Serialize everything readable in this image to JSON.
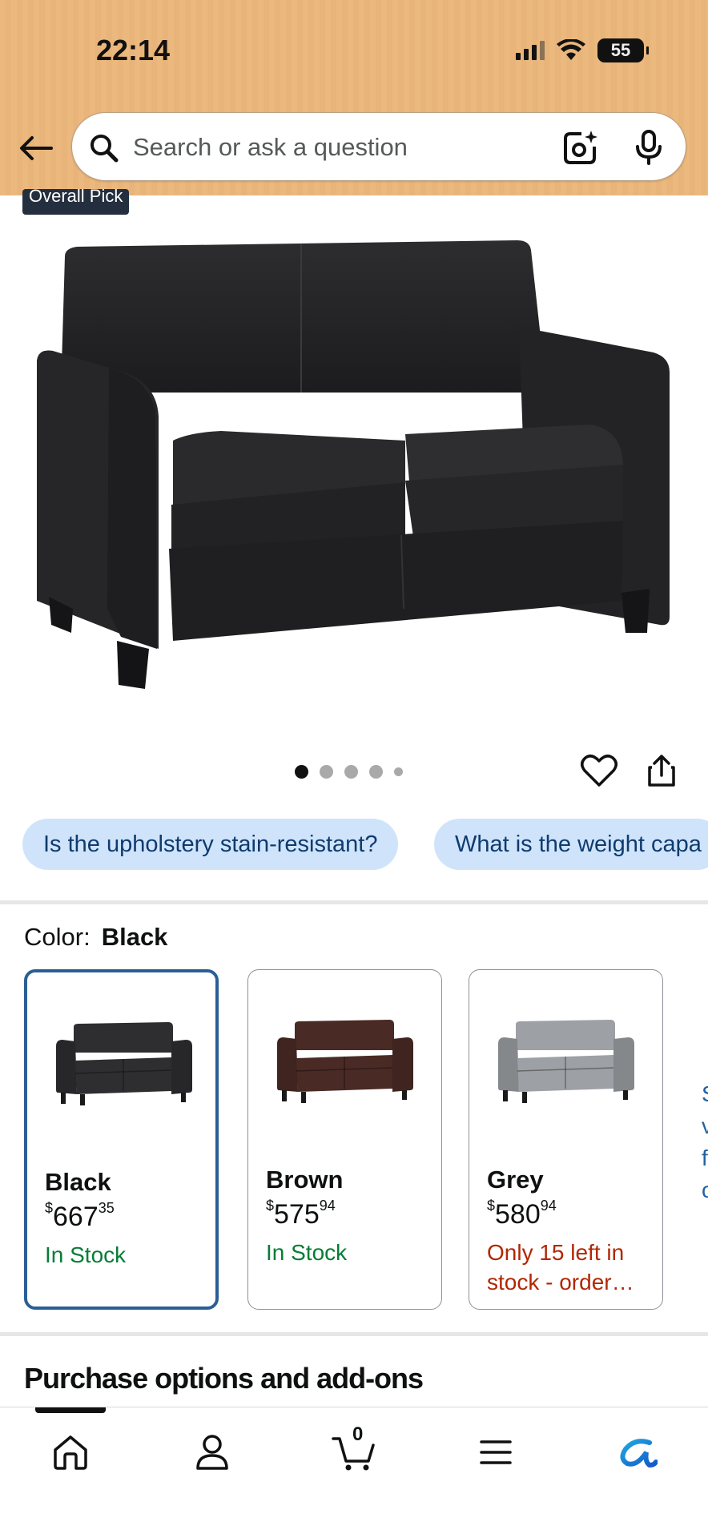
{
  "status_bar": {
    "time": "22:14",
    "battery": "55"
  },
  "search": {
    "placeholder": "Search or ask a question"
  },
  "product": {
    "badge": "Overall Pick"
  },
  "gallery": {
    "image_count": 5,
    "active_index": 0
  },
  "questions": [
    "Is the upholstery stain-resistant?",
    "What is the weight capa"
  ],
  "color": {
    "label": "Color:",
    "selected": "Black"
  },
  "variants": [
    {
      "name": "Black",
      "currency": "$",
      "price_whole": "667",
      "price_fraction": "35",
      "stock": "In Stock",
      "stock_status": "in-stock",
      "swatch_color": "#2e2e30",
      "selected": true
    },
    {
      "name": "Brown",
      "currency": "$",
      "price_whole": "575",
      "price_fraction": "94",
      "stock": "In Stock",
      "stock_status": "in-stock",
      "swatch_color": "#4a2a24",
      "selected": false
    },
    {
      "name": "Grey",
      "currency": "$",
      "price_whole": "580",
      "price_fraction": "94",
      "stock": "Only 15 left in stock - order…",
      "stock_status": "low-stock",
      "swatch_color": "#9da0a4",
      "selected": false
    }
  ],
  "more_link": [
    "S",
    "v",
    "f",
    "c"
  ],
  "purchase_section": {
    "title": "Purchase options and add-ons"
  },
  "bottom_nav": {
    "items": [
      "home-icon",
      "account-icon",
      "cart-icon",
      "menu-icon",
      "rufus-icon"
    ],
    "cart_count": "0"
  },
  "colors": {
    "accent_blue": "#2a5f96",
    "in_stock": "#067d35",
    "low_stock": "#b12704",
    "chip_bg": "#cfe4fb",
    "header": "#ebb87e"
  }
}
